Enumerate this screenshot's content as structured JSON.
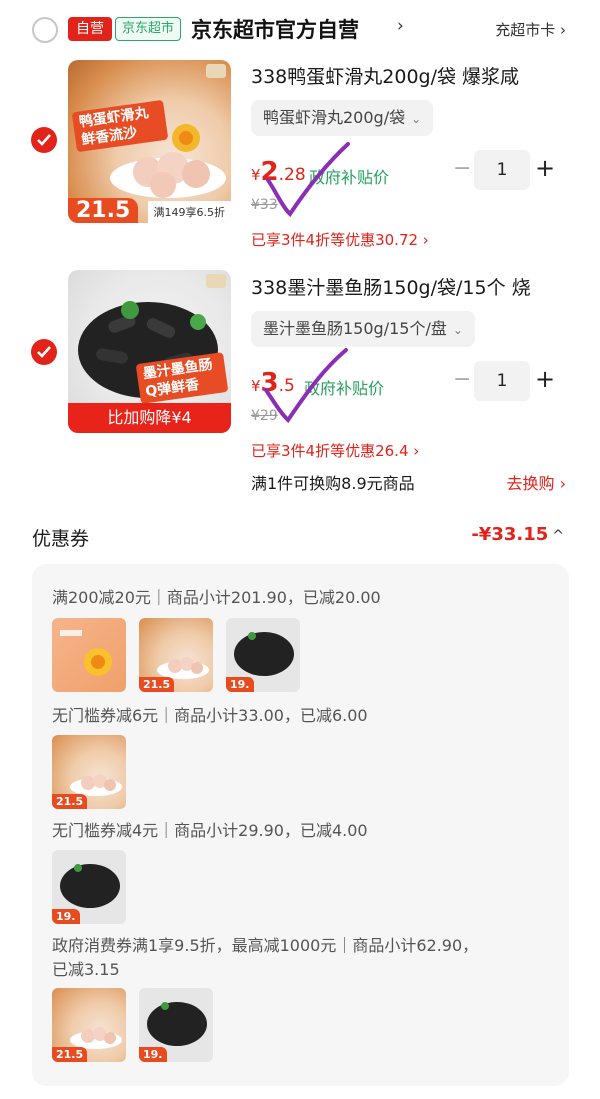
{
  "store": {
    "badge_self": "自营",
    "badge_market": "京东超市",
    "name": "京东超市官方自营",
    "chevron": "›",
    "recharge": "充超市卡 ›"
  },
  "products": [
    {
      "title": "338鸭蛋虾滑丸200g/袋 爆浆咸",
      "spec": "鸭蛋虾滑丸200g/袋",
      "price_symbol": "¥",
      "price_main": "2",
      "price_decimal": ".28",
      "gov_label": "政府补贴价",
      "orig_price": "¥33",
      "qty": "1",
      "discount": "已享3件4折等优惠30.72 ›",
      "thumb_price": "21.5",
      "thumb_promo": "满149享6.5折",
      "thumb_ribbon": "鸭蛋虾滑丸 鲜香流沙"
    },
    {
      "title": "338墨汁墨鱼肠150g/袋/15个 烧",
      "spec": "墨汁墨鱼肠150g/15个/盘",
      "price_symbol": "¥",
      "price_main": "3",
      "price_decimal": ".5",
      "gov_label": "政府补贴价",
      "orig_price": "¥29",
      "qty": "1",
      "discount": "已享3件4折等优惠26.4 ›",
      "thumb_banner": "比加购降¥4",
      "thumb_ribbon": "墨汁墨鱼肠 Q弹鲜香"
    }
  ],
  "swap": {
    "text": "满1件可换购8.9元商品",
    "link": "去换购 ›"
  },
  "coupons": {
    "title": "优惠券",
    "total": "-¥33.15",
    "toggle": "^",
    "lines": [
      "满200减20元｜商品小计201.90，已减20.00",
      "无门槛券减6元｜商品小计33.00，已减6.00",
      "无门槛券减4元｜商品小计29.90，已减4.00",
      "政府消费券满1享9.5折，最高减1000元｜商品小计62.90，",
      "已减3.15"
    ],
    "mini_prices": {
      "shrimp": "21.5",
      "squid": "19."
    }
  },
  "colors": {
    "accent": "#e2231a",
    "green": "#27a060",
    "purple_tick": "#8a2fb5"
  },
  "icons": [
    "checkbox-checked-icon",
    "checkbox-empty-icon",
    "chevron-right-icon",
    "chevron-down-icon",
    "chevron-up-icon",
    "handwritten-tick"
  ]
}
